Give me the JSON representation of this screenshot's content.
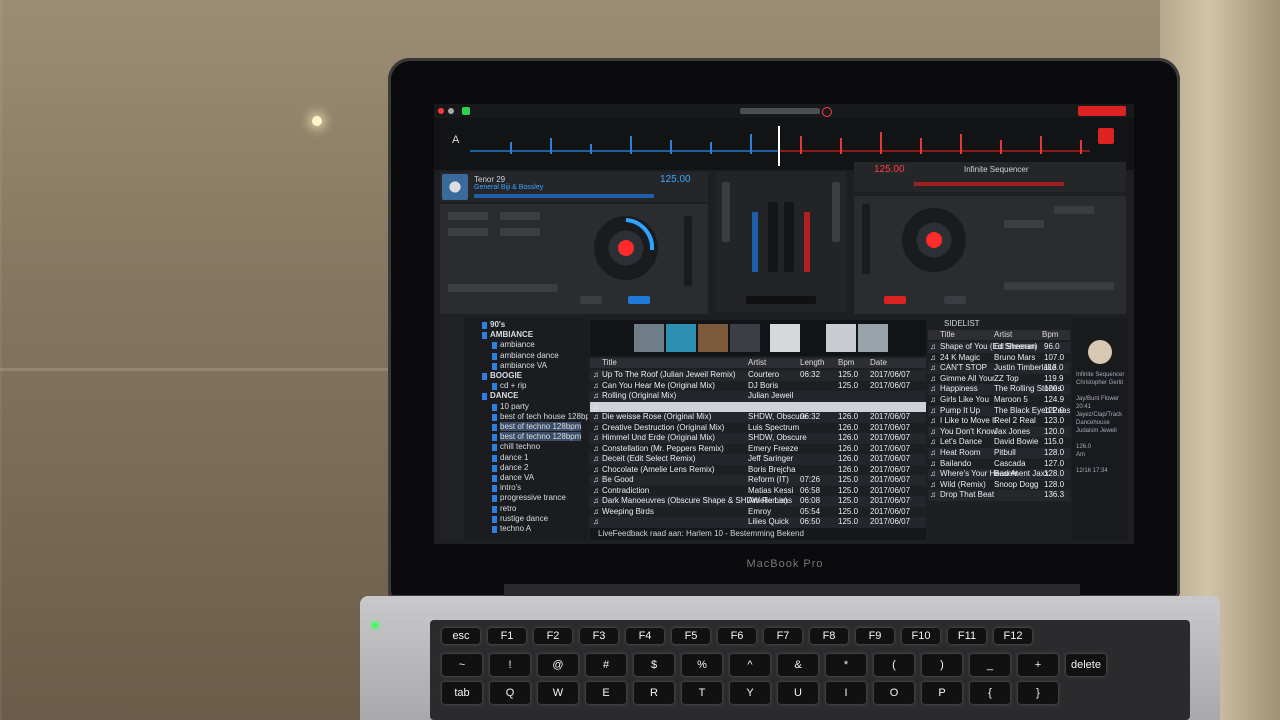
{
  "app": {
    "deckA_label": "A",
    "deckA": {
      "title": "Tenor 29",
      "artist": "General Biji & Bossley",
      "bpm": "125.00"
    },
    "deckB": {
      "title": "Infinite Sequencer",
      "bpm": "125.00"
    },
    "browser_header": "SIDELIST",
    "info_panel": [
      "Infinite Sequencer",
      "Christopher Gerlit",
      "",
      "Jay/Bunt Flower",
      "20:41",
      "Jayez/Clap/Track",
      "Dancehouse",
      "Judaism Jewell",
      "",
      "126.0",
      "Am",
      "",
      "12/16 17:34"
    ]
  },
  "columns": {
    "title": "Title",
    "artist": "Artist",
    "length": "Length",
    "bpm": "Bpm",
    "date": "Date"
  },
  "folders": [
    "90's",
    "AMBIANCE",
    "ambiance",
    "ambiance dance",
    "ambiance VA",
    "BOOGIE",
    "cd + rip",
    "DANCE",
    "10 party",
    "best of tech house 128bpm",
    "best of techno 128bpm",
    "best of techno 128bpm",
    "chill techno",
    "dance 1",
    "dance 2",
    "dance VA",
    "intro's",
    "progressive trance",
    "retro",
    "rustige dance",
    "techno A"
  ],
  "tracks": [
    {
      "title": "Up To The Roof (Julian Jeweil Remix)",
      "artist": "Courtero",
      "length": "06:32",
      "bpm": "125.0",
      "date": "2017/06/07"
    },
    {
      "title": "Can You Hear Me (Original Mix)",
      "artist": "DJ Boris",
      "length": "",
      "bpm": "125.0",
      "date": "2017/06/07"
    },
    {
      "title": "Rolling (Original Mix)",
      "artist": "Julian Jeweil",
      "length": "",
      "bpm": "",
      "date": ""
    },
    {
      "title": "",
      "artist": "",
      "length": "",
      "bpm": "",
      "date": ""
    },
    {
      "title": "Die weisse Rose (Original Mix)",
      "artist": "SHDW, Obscure",
      "length": "06:32",
      "bpm": "126.0",
      "date": "2017/06/07"
    },
    {
      "title": "Creative Destruction (Original Mix)",
      "artist": "Luis Spectrum",
      "length": "",
      "bpm": "126.0",
      "date": "2017/06/07"
    },
    {
      "title": "Himmel Und Erde (Original Mix)",
      "artist": "SHDW, Obscure",
      "length": "",
      "bpm": "126.0",
      "date": "2017/06/07"
    },
    {
      "title": "Constellation (Mr. Peppers Remix)",
      "artist": "Emery Freeze",
      "length": "",
      "bpm": "126.0",
      "date": "2017/06/07"
    },
    {
      "title": "Deceit (Edit Select Remix)",
      "artist": "Jeff Saringer",
      "length": "",
      "bpm": "126.0",
      "date": "2017/06/07"
    },
    {
      "title": "Chocolate (Amelie Lens Remix)",
      "artist": "Boris Brejcha",
      "length": "",
      "bpm": "126.0",
      "date": "2017/06/07"
    },
    {
      "title": "Be Good",
      "artist": "Reform (IT)",
      "length": "07:26",
      "bpm": "125.0",
      "date": "2017/06/07"
    },
    {
      "title": "Contradiction",
      "artist": "Matias Kessi",
      "length": "06:58",
      "bpm": "125.0",
      "date": "2017/06/07"
    },
    {
      "title": "Dark Manoeuvres (Obscure Shape & SHDW Remix)",
      "artist": "Amelie Lens",
      "length": "06:08",
      "bpm": "125.0",
      "date": "2017/06/07"
    },
    {
      "title": "Weeping Birds",
      "artist": "Emroy",
      "length": "05:54",
      "bpm": "125.0",
      "date": "2017/06/07"
    },
    {
      "title": "",
      "artist": "Lilies Quick",
      "length": "06:50",
      "bpm": "125.0",
      "date": "2017/06/07"
    }
  ],
  "sidelist": [
    {
      "title": "Shape of You (Ed Sheeran)",
      "artist": "Ed Sheeran",
      "bpm": "96.0"
    },
    {
      "title": "24 K Magic",
      "artist": "Bruno Mars",
      "bpm": "107.0"
    },
    {
      "title": "CAN'T STOP",
      "artist": "Justin Timberlake",
      "bpm": "113.0"
    },
    {
      "title": "Gimme All Your",
      "artist": "ZZ Top",
      "bpm": "119.9"
    },
    {
      "title": "Happiness",
      "artist": "The Rolling Stones",
      "bpm": "120.0"
    },
    {
      "title": "Girls Like You",
      "artist": "Maroon 5",
      "bpm": "124.9"
    },
    {
      "title": "Pump It Up",
      "artist": "The Black Eyed Peas",
      "bpm": "122.0"
    },
    {
      "title": "I Like to Move It",
      "artist": "Reel 2 Real",
      "bpm": "123.0"
    },
    {
      "title": "You Don't Know",
      "artist": "Jax Jones",
      "bpm": "120.0"
    },
    {
      "title": "Let's Dance",
      "artist": "David Bowie",
      "bpm": "115.0"
    },
    {
      "title": "Heat Room",
      "artist": "Pitbull",
      "bpm": "128.0"
    },
    {
      "title": "Bailando",
      "artist": "Cascada",
      "bpm": "127.0"
    },
    {
      "title": "Where's Your Head At",
      "artist": "Basement Jaxx",
      "bpm": "128.0"
    },
    {
      "title": "Wild (Remix)",
      "artist": "Snoop Dogg",
      "bpm": "128.0"
    },
    {
      "title": "Drop That Beat",
      "artist": "",
      "bpm": "136.3"
    }
  ],
  "status_text": "LiveFeedback raad aan: Harlem 10 - Bestemming Bekend",
  "laptop_brand": "MacBook Pro",
  "keyboard": {
    "row1": [
      "esc",
      "F1",
      "F2",
      "F3",
      "F4",
      "F5",
      "F6",
      "F7",
      "F8",
      "F9",
      "F10",
      "F11",
      "F12"
    ],
    "row2": [
      "~",
      "!",
      "@",
      "#",
      "$",
      "%",
      "^",
      "&",
      "*",
      "(",
      ")",
      "_",
      "+",
      "delete"
    ],
    "row3": [
      "tab",
      "Q",
      "W",
      "E",
      "R",
      "T",
      "Y",
      "U",
      "I",
      "O",
      "P",
      "{",
      "}"
    ]
  },
  "colors": {
    "deckA": "#39a4ff",
    "deckB": "#ff3b3b",
    "panel": "#2b2d31",
    "highlight": "#cfd3d8"
  }
}
